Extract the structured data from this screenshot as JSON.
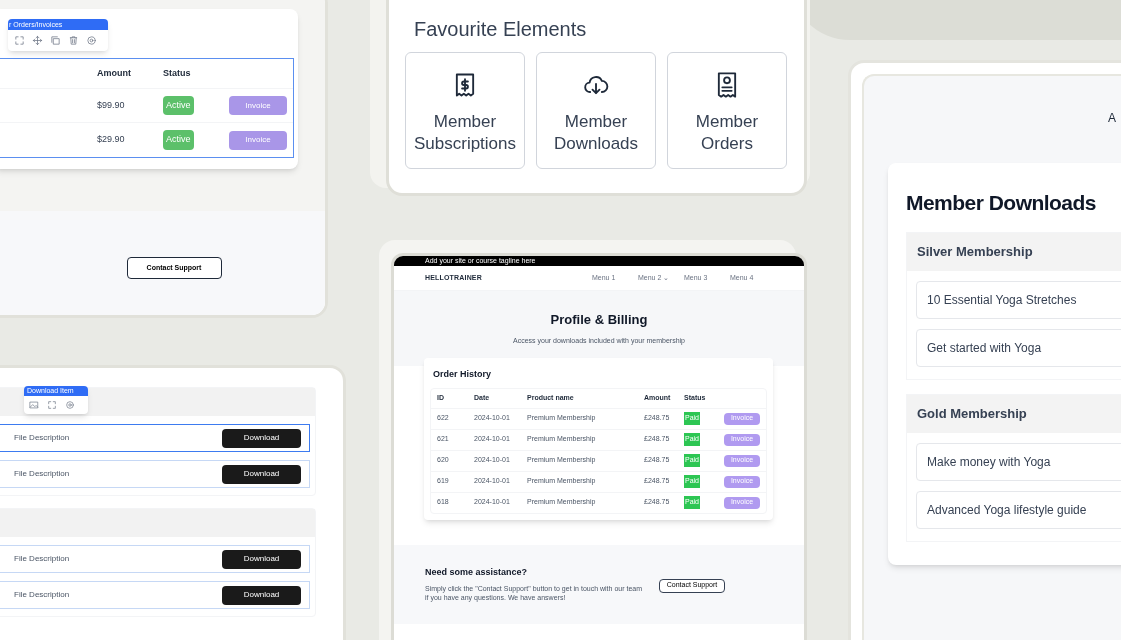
{
  "orders_panel": {
    "toolbar": {
      "label": "r Orders/Invoices"
    },
    "columns": [
      "Amount",
      "Status"
    ],
    "rows": [
      {
        "amount": "$99.90",
        "status": "Active",
        "action": "Invoice"
      },
      {
        "amount": "$29.90",
        "status": "Active",
        "action": "Invoice"
      }
    ],
    "support_button": "Contact Support"
  },
  "downloads_panel": {
    "toolbar": {
      "label": "Download Item"
    },
    "groups": [
      {
        "items": [
          {
            "description": "File Description",
            "button": "Download",
            "selected": true
          },
          {
            "description": "File Description",
            "button": "Download",
            "selected": false
          }
        ]
      },
      {
        "items": [
          {
            "description": "File Description",
            "button": "Download",
            "selected": false
          },
          {
            "description": "File Description",
            "button": "Download",
            "selected": false
          }
        ]
      }
    ]
  },
  "favourites": {
    "title": "Favourite Elements",
    "tiles": [
      {
        "kind": "receipt",
        "label": "Member Subscriptions"
      },
      {
        "kind": "cloud",
        "label": "Member Downloads"
      },
      {
        "kind": "document",
        "label": "Member Orders"
      }
    ]
  },
  "site_preview": {
    "tagline": "Add your site or course tagline here",
    "logo": "HELLOTRAINER",
    "menu": [
      "Menu 1",
      "Menu 2 ⌄",
      "Menu 3",
      "Menu 4"
    ],
    "title": "Profile & Billing",
    "subtitle": "Access your downloads included with your membership",
    "order_history": {
      "title": "Order History",
      "columns": [
        "ID",
        "Date",
        "Product name",
        "Amount",
        "Status"
      ],
      "rows": [
        {
          "id": "622",
          "date": "2024-10-01",
          "product": "Premium Membership",
          "amount": "£248.75",
          "status": "Paid",
          "action": "Invoice"
        },
        {
          "id": "621",
          "date": "2024-10-01",
          "product": "Premium Membership",
          "amount": "£248.75",
          "status": "Paid",
          "action": "Invoice"
        },
        {
          "id": "620",
          "date": "2024-10-01",
          "product": "Premium Membership",
          "amount": "£248.75",
          "status": "Paid",
          "action": "Invoice"
        },
        {
          "id": "619",
          "date": "2024-10-01",
          "product": "Premium Membership",
          "amount": "£248.75",
          "status": "Paid",
          "action": "Invoice"
        },
        {
          "id": "618",
          "date": "2024-10-01",
          "product": "Premium Membership",
          "amount": "£248.75",
          "status": "Paid",
          "action": "Invoice"
        }
      ]
    },
    "assistance": {
      "title": "Need some assistance?",
      "text": "Simply click the \"Contact Support\" button to get in touch with our team if you have any questions. We have answers!",
      "button": "Contact Support"
    }
  },
  "member_downloads": {
    "cut_text": "A",
    "title": "Member Downloads",
    "groups": [
      {
        "name": "Silver Membership",
        "items": [
          "10 Essential Yoga Stretches",
          "Get started with Yoga"
        ]
      },
      {
        "name": "Gold Membership",
        "items": [
          "Make money with Yoga",
          "Advanced Yoga lifestyle guide"
        ]
      }
    ]
  }
}
